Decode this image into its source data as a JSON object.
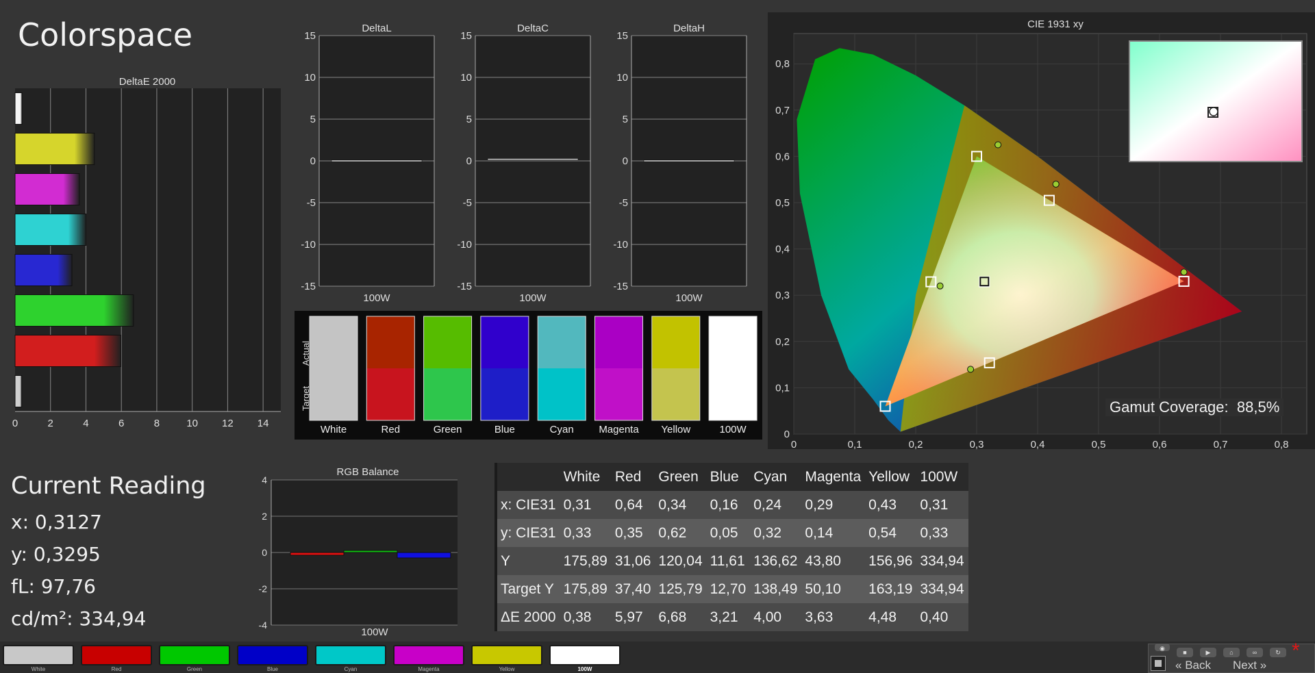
{
  "title": "Colorspace",
  "deltae": {
    "title": "DeltaE 2000",
    "xticks": [
      "0",
      "2",
      "4",
      "6",
      "8",
      "10",
      "12",
      "14"
    ],
    "xmax": 15,
    "bars": [
      {
        "name": "100W",
        "value": 0.4,
        "color": "#f5f5f5"
      },
      {
        "name": "Yellow",
        "value": 4.48,
        "color": "#d6d52c"
      },
      {
        "name": "Magenta",
        "value": 3.63,
        "color": "#d22cd2"
      },
      {
        "name": "Cyan",
        "value": 4.0,
        "color": "#2ed2d2"
      },
      {
        "name": "Blue",
        "value": 3.21,
        "color": "#2828d2"
      },
      {
        "name": "Green",
        "value": 6.68,
        "color": "#2ed22e"
      },
      {
        "name": "Red",
        "value": 5.97,
        "color": "#d21e1e"
      },
      {
        "name": "White",
        "value": 0.38,
        "color": "#d0d0d0"
      }
    ]
  },
  "deltas": [
    {
      "title": "DeltaL",
      "label": "100W",
      "value": 0.0
    },
    {
      "title": "DeltaC",
      "label": "100W",
      "value": 0.2
    },
    {
      "title": "DeltaH",
      "label": "100W",
      "value": 0.0
    }
  ],
  "delta_ticks": [
    "15",
    "10",
    "5",
    "0",
    "-5",
    "-10",
    "-15"
  ],
  "comparison": {
    "actual_label": "Actual",
    "target_label": "Target",
    "patches": [
      {
        "name": "White",
        "actual": "#c4c4c4",
        "target": "#c4c4c4"
      },
      {
        "name": "Red",
        "actual": "#a82400",
        "target": "#c8141e"
      },
      {
        "name": "Green",
        "actual": "#56bc00",
        "target": "#2ec64c"
      },
      {
        "name": "Blue",
        "actual": "#3000cc",
        "target": "#1e1ec8"
      },
      {
        "name": "Cyan",
        "actual": "#52b8be",
        "target": "#00c2c8"
      },
      {
        "name": "Magenta",
        "actual": "#aa00c4",
        "target": "#c010c8"
      },
      {
        "name": "Yellow",
        "actual": "#c2c200",
        "target": "#c4c44e"
      },
      {
        "name": "100W",
        "actual": "#ffffff",
        "target": "#ffffff"
      }
    ]
  },
  "cie": {
    "title": "CIE 1931 xy",
    "xticks": [
      "0",
      "0,1",
      "0,2",
      "0,3",
      "0,4",
      "0,5",
      "0,6",
      "0,7",
      "0,8"
    ],
    "yticks": [
      "0",
      "0,1",
      "0,2",
      "0,3",
      "0,4",
      "0,5",
      "0,6",
      "0,7",
      "0,8"
    ],
    "gamut_label": "Gamut Coverage:",
    "gamut_value": "88,5%",
    "targets": [
      [
        0.64,
        0.33
      ],
      [
        0.3,
        0.6
      ],
      [
        0.15,
        0.06
      ],
      [
        0.225,
        0.329
      ],
      [
        0.321,
        0.154
      ],
      [
        0.419,
        0.505
      ],
      [
        0.3127,
        0.329
      ]
    ],
    "measured": [
      [
        0.64,
        0.35
      ],
      [
        0.335,
        0.625
      ],
      [
        0.24,
        0.32
      ],
      [
        0.29,
        0.14
      ],
      [
        0.43,
        0.54
      ]
    ],
    "white_measured": [
      0.3127,
      0.3295
    ]
  },
  "current": {
    "title": "Current Reading",
    "x": "x: 0,3127",
    "y": "y: 0,3295",
    "fl": "fL: 97,76",
    "cd": "cd/m²: 334,94"
  },
  "rgb_balance": {
    "title": "RGB Balance",
    "yticks": [
      "4",
      "2",
      "0",
      "-2",
      "-4"
    ],
    "label": "100W",
    "values": [
      {
        "color": "#e01010",
        "value": -0.15
      },
      {
        "color": "#10c010",
        "value": 0.1
      },
      {
        "color": "#1010e0",
        "value": -0.3
      }
    ]
  },
  "table": {
    "headers": [
      "",
      "White",
      "Red",
      "Green",
      "Blue",
      "Cyan",
      "Magenta",
      "Yellow",
      "100W"
    ],
    "rows": [
      [
        "x: CIE31",
        "0,31",
        "0,64",
        "0,34",
        "0,16",
        "0,24",
        "0,29",
        "0,43",
        "0,31"
      ],
      [
        "y: CIE31",
        "0,33",
        "0,35",
        "0,62",
        "0,05",
        "0,32",
        "0,14",
        "0,54",
        "0,33"
      ],
      [
        "Y",
        "175,89",
        "31,06",
        "120,04",
        "11,61",
        "136,62",
        "43,80",
        "156,96",
        "334,94"
      ],
      [
        "Target Y",
        "175,89",
        "37,40",
        "125,79",
        "12,70",
        "138,49",
        "50,10",
        "163,19",
        "334,94"
      ],
      [
        "ΔE 2000",
        "0,38",
        "5,97",
        "6,68",
        "3,21",
        "4,00",
        "3,63",
        "4,48",
        "0,40"
      ]
    ]
  },
  "bottom": {
    "swatches": [
      {
        "label": "White",
        "color": "#c8c8c8"
      },
      {
        "label": "Red",
        "color": "#c80000"
      },
      {
        "label": "Green",
        "color": "#00c800"
      },
      {
        "label": "Blue",
        "color": "#0000c8"
      },
      {
        "label": "Cyan",
        "color": "#00c8c8"
      },
      {
        "label": "Magenta",
        "color": "#c800c8"
      },
      {
        "label": "Yellow",
        "color": "#c8c800"
      },
      {
        "label": "100W",
        "color": "#ffffff"
      }
    ],
    "back": "Back",
    "next": "Next"
  }
}
